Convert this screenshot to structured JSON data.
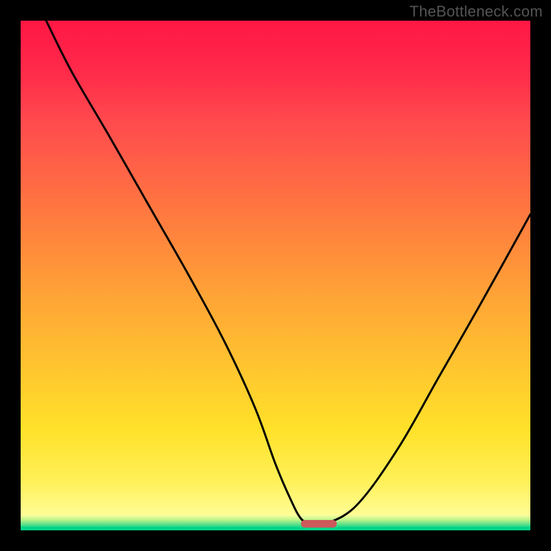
{
  "watermark": "TheBottleneck.com",
  "colors": {
    "background": "#000000",
    "gradient_top": "#ff1744",
    "gradient_mid": "#ffc52f",
    "gradient_bottom": "#ffff9e",
    "target_band": "#00d488",
    "curve": "#000000",
    "marker": "#cc5a5a"
  },
  "chart_data": {
    "type": "line",
    "title": "",
    "xlabel": "",
    "ylabel": "",
    "xlim": [
      0,
      100
    ],
    "ylim": [
      0,
      100
    ],
    "series": [
      {
        "name": "bottleneck-curve",
        "x": [
          5,
          10,
          17,
          25,
          33,
          40,
          46,
          50,
          53,
          55,
          57,
          58.5,
          60,
          66,
          74,
          82,
          90,
          100
        ],
        "values": [
          100,
          90,
          78,
          64,
          50,
          37,
          24,
          13,
          6,
          2.3,
          1.2,
          1.2,
          1.3,
          5,
          16,
          30,
          44,
          62
        ]
      }
    ],
    "annotations": [
      {
        "name": "optimal-range",
        "x_start": 55,
        "x_end": 62,
        "y": 1.4
      }
    ],
    "grid": false,
    "legend": false
  }
}
